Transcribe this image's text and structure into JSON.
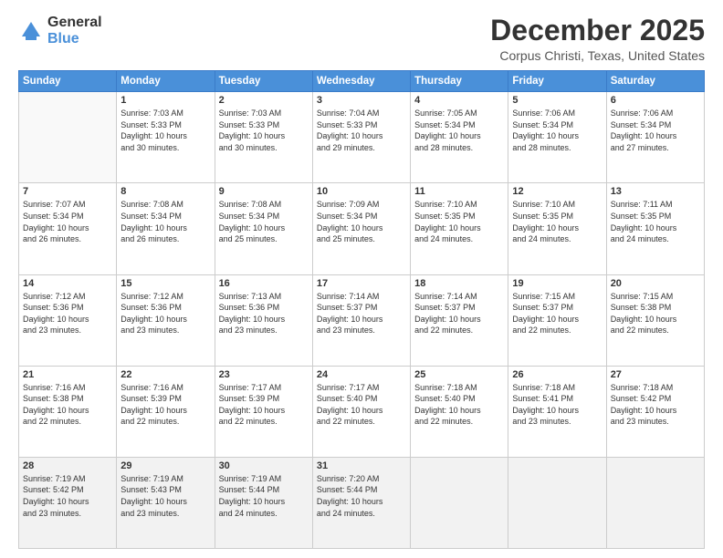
{
  "logo": {
    "general": "General",
    "blue": "Blue"
  },
  "header": {
    "title": "December 2025",
    "location": "Corpus Christi, Texas, United States"
  },
  "weekdays": [
    "Sunday",
    "Monday",
    "Tuesday",
    "Wednesday",
    "Thursday",
    "Friday",
    "Saturday"
  ],
  "weeks": [
    [
      {
        "day": "",
        "info": ""
      },
      {
        "day": "1",
        "info": "Sunrise: 7:03 AM\nSunset: 5:33 PM\nDaylight: 10 hours\nand 30 minutes."
      },
      {
        "day": "2",
        "info": "Sunrise: 7:03 AM\nSunset: 5:33 PM\nDaylight: 10 hours\nand 30 minutes."
      },
      {
        "day": "3",
        "info": "Sunrise: 7:04 AM\nSunset: 5:33 PM\nDaylight: 10 hours\nand 29 minutes."
      },
      {
        "day": "4",
        "info": "Sunrise: 7:05 AM\nSunset: 5:34 PM\nDaylight: 10 hours\nand 28 minutes."
      },
      {
        "day": "5",
        "info": "Sunrise: 7:06 AM\nSunset: 5:34 PM\nDaylight: 10 hours\nand 28 minutes."
      },
      {
        "day": "6",
        "info": "Sunrise: 7:06 AM\nSunset: 5:34 PM\nDaylight: 10 hours\nand 27 minutes."
      }
    ],
    [
      {
        "day": "7",
        "info": "Sunrise: 7:07 AM\nSunset: 5:34 PM\nDaylight: 10 hours\nand 26 minutes."
      },
      {
        "day": "8",
        "info": "Sunrise: 7:08 AM\nSunset: 5:34 PM\nDaylight: 10 hours\nand 26 minutes."
      },
      {
        "day": "9",
        "info": "Sunrise: 7:08 AM\nSunset: 5:34 PM\nDaylight: 10 hours\nand 25 minutes."
      },
      {
        "day": "10",
        "info": "Sunrise: 7:09 AM\nSunset: 5:34 PM\nDaylight: 10 hours\nand 25 minutes."
      },
      {
        "day": "11",
        "info": "Sunrise: 7:10 AM\nSunset: 5:35 PM\nDaylight: 10 hours\nand 24 minutes."
      },
      {
        "day": "12",
        "info": "Sunrise: 7:10 AM\nSunset: 5:35 PM\nDaylight: 10 hours\nand 24 minutes."
      },
      {
        "day": "13",
        "info": "Sunrise: 7:11 AM\nSunset: 5:35 PM\nDaylight: 10 hours\nand 24 minutes."
      }
    ],
    [
      {
        "day": "14",
        "info": "Sunrise: 7:12 AM\nSunset: 5:36 PM\nDaylight: 10 hours\nand 23 minutes."
      },
      {
        "day": "15",
        "info": "Sunrise: 7:12 AM\nSunset: 5:36 PM\nDaylight: 10 hours\nand 23 minutes."
      },
      {
        "day": "16",
        "info": "Sunrise: 7:13 AM\nSunset: 5:36 PM\nDaylight: 10 hours\nand 23 minutes."
      },
      {
        "day": "17",
        "info": "Sunrise: 7:14 AM\nSunset: 5:37 PM\nDaylight: 10 hours\nand 23 minutes."
      },
      {
        "day": "18",
        "info": "Sunrise: 7:14 AM\nSunset: 5:37 PM\nDaylight: 10 hours\nand 22 minutes."
      },
      {
        "day": "19",
        "info": "Sunrise: 7:15 AM\nSunset: 5:37 PM\nDaylight: 10 hours\nand 22 minutes."
      },
      {
        "day": "20",
        "info": "Sunrise: 7:15 AM\nSunset: 5:38 PM\nDaylight: 10 hours\nand 22 minutes."
      }
    ],
    [
      {
        "day": "21",
        "info": "Sunrise: 7:16 AM\nSunset: 5:38 PM\nDaylight: 10 hours\nand 22 minutes."
      },
      {
        "day": "22",
        "info": "Sunrise: 7:16 AM\nSunset: 5:39 PM\nDaylight: 10 hours\nand 22 minutes."
      },
      {
        "day": "23",
        "info": "Sunrise: 7:17 AM\nSunset: 5:39 PM\nDaylight: 10 hours\nand 22 minutes."
      },
      {
        "day": "24",
        "info": "Sunrise: 7:17 AM\nSunset: 5:40 PM\nDaylight: 10 hours\nand 22 minutes."
      },
      {
        "day": "25",
        "info": "Sunrise: 7:18 AM\nSunset: 5:40 PM\nDaylight: 10 hours\nand 22 minutes."
      },
      {
        "day": "26",
        "info": "Sunrise: 7:18 AM\nSunset: 5:41 PM\nDaylight: 10 hours\nand 23 minutes."
      },
      {
        "day": "27",
        "info": "Sunrise: 7:18 AM\nSunset: 5:42 PM\nDaylight: 10 hours\nand 23 minutes."
      }
    ],
    [
      {
        "day": "28",
        "info": "Sunrise: 7:19 AM\nSunset: 5:42 PM\nDaylight: 10 hours\nand 23 minutes."
      },
      {
        "day": "29",
        "info": "Sunrise: 7:19 AM\nSunset: 5:43 PM\nDaylight: 10 hours\nand 23 minutes."
      },
      {
        "day": "30",
        "info": "Sunrise: 7:19 AM\nSunset: 5:44 PM\nDaylight: 10 hours\nand 24 minutes."
      },
      {
        "day": "31",
        "info": "Sunrise: 7:20 AM\nSunset: 5:44 PM\nDaylight: 10 hours\nand 24 minutes."
      },
      {
        "day": "",
        "info": ""
      },
      {
        "day": "",
        "info": ""
      },
      {
        "day": "",
        "info": ""
      }
    ]
  ]
}
